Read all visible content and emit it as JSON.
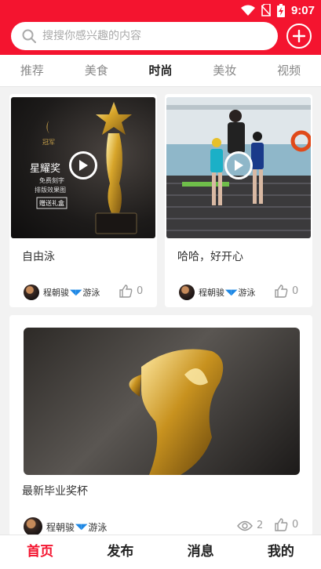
{
  "status": {
    "time": "9:07"
  },
  "search": {
    "placeholder": "搜搜你感兴趣的内容"
  },
  "tabs": [
    "推荐",
    "美食",
    "时尚",
    "美妆",
    "视频"
  ],
  "active_tab": 2,
  "cards": [
    {
      "title": "自由泳",
      "author": "程朝骏",
      "author_suffix": "游泳",
      "likes": "0",
      "thumb_text": {
        "badge": "星耀奖",
        "line1": "免费刻字",
        "line2": "排版效果图",
        "gift": "赠送礼盒",
        "brand": "冠军"
      }
    },
    {
      "title": "哈哈，好开心",
      "author": "程朝骏",
      "author_suffix": "游泳",
      "likes": "0"
    },
    {
      "title": "最新毕业奖杯",
      "author": "程朝骏",
      "author_suffix": "游泳",
      "views": "2",
      "likes": "0"
    }
  ],
  "bottom_nav": [
    "首页",
    "发布",
    "消息",
    "我的"
  ],
  "active_nav": 0,
  "colors": {
    "brand": "#f4142f",
    "background": "#f2f2f2"
  }
}
